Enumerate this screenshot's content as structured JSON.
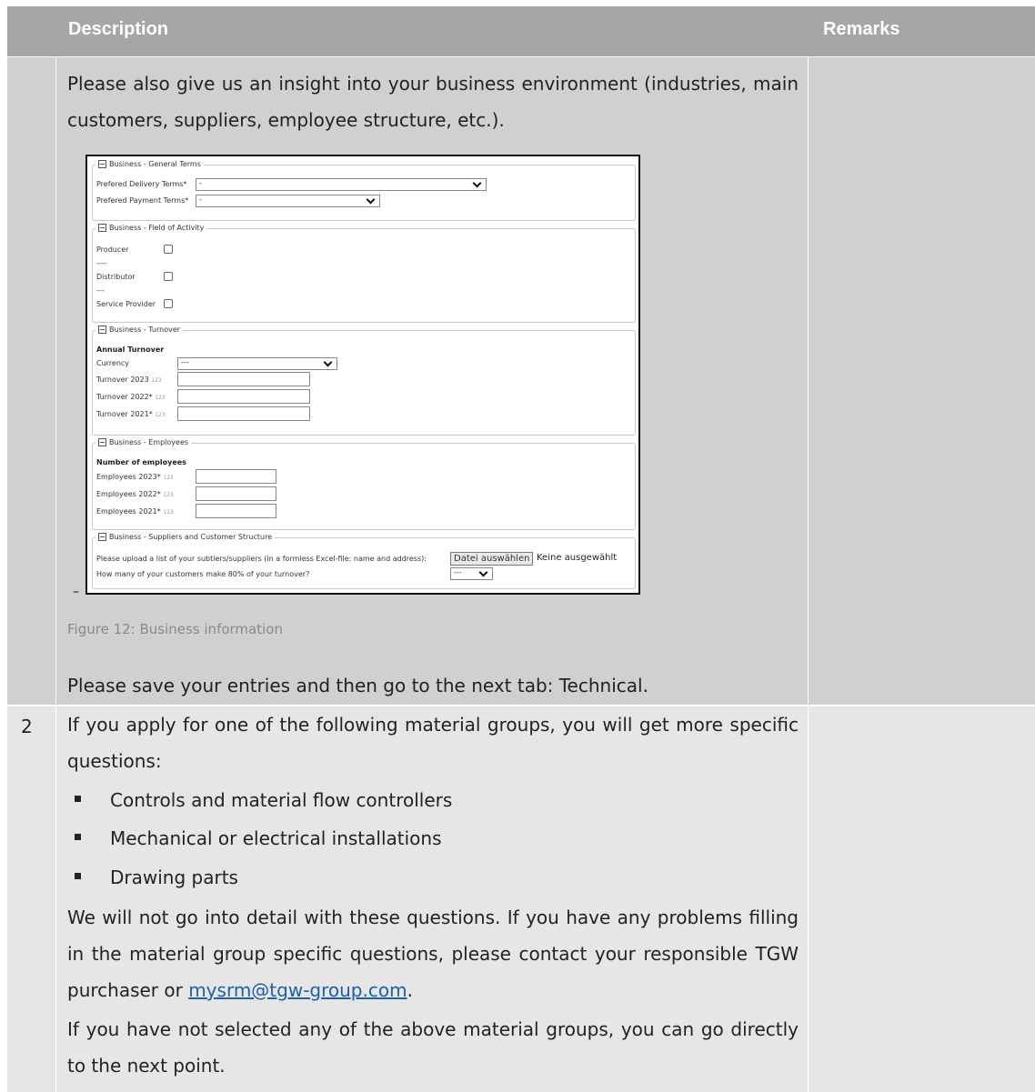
{
  "header": {
    "col_description": "Description",
    "col_remarks": "Remarks"
  },
  "row1": {
    "intro": "Please also give us an insight into your business environment (industries, main customers, suppliers, employee structure, etc.).",
    "caption": "Figure 12: Business information",
    "outro": "Please save your entries and then go to the next tab: Technical."
  },
  "form": {
    "general": {
      "legend": "Business - General Terms",
      "delivery_label": "Prefered Delivery Terms*",
      "delivery_value": "-",
      "payment_label": "Prefered Payment Terms*",
      "payment_value": "-"
    },
    "activity": {
      "legend": "Business - Field of Activity",
      "producer": "Producer",
      "sep1": "----",
      "distributor": "Distributor",
      "sep2": "---",
      "service": "Service Provider"
    },
    "turnover": {
      "legend": "Business - Turnover",
      "heading": "Annual Turnover",
      "currency_label": "Currency",
      "currency_value": "---",
      "t2023": "Turnover 2023",
      "t2022": "Turnover 2022*",
      "t2021": "Turnover 2021*",
      "suffix": "123"
    },
    "employees": {
      "legend": "Business - Employees",
      "heading": "Number of employees",
      "e2023": "Employees 2023*",
      "e2022": "Employees 2022*",
      "e2021": "Employees 2021*",
      "suffix": "123"
    },
    "suppliers": {
      "legend": "Business - Suppliers and Customer Structure",
      "upload_label": "Please upload a list of your subtiers/suppliers (in a formless Excel-file: name and address):",
      "upload_button": "Datei auswählen",
      "no_file": "Keine ausgewählt",
      "customers_label": "How many of your customers make 80% of your turnover?",
      "customers_value": "---"
    },
    "dash": "–"
  },
  "row2": {
    "number": "2",
    "intro": "If you apply for one of the following material groups, you will get more specific questions:",
    "bullets": [
      "Controls and material flow controllers",
      "Mechanical or electrical installations",
      "Drawing parts"
    ],
    "para1_a": "We will not go into detail with these questions. If you have any problems filling in the material group specific questions, please contact your responsible TGW purchaser or ",
    "email": "mysrm@tgw-group.com",
    "para1_end": ".",
    "para2": "If you have not selected any of the above material groups, you can go directly to the next point."
  }
}
